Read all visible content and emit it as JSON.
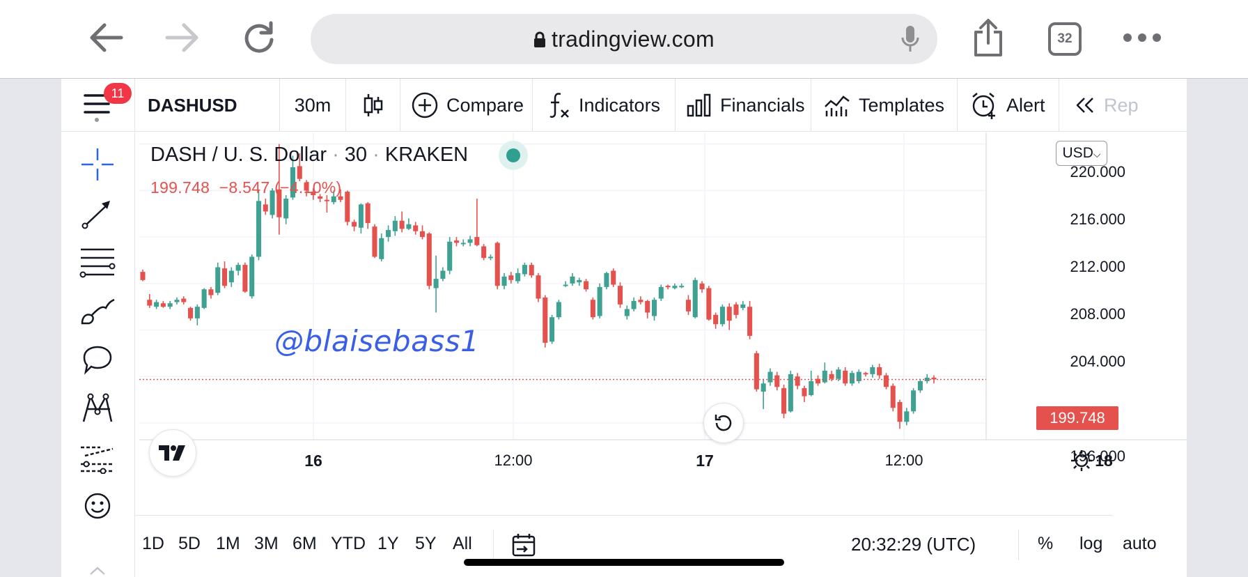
{
  "browser": {
    "url": "tradingview.com",
    "tab_count": "32",
    "icons": [
      "back-arrow-icon",
      "forward-arrow-icon",
      "reload-icon",
      "lock-icon",
      "microphone-icon",
      "share-icon",
      "tabs-icon",
      "more-icon"
    ]
  },
  "app": {
    "notification_count": "11",
    "toolbar": {
      "symbol": "DASHUSD",
      "interval": "30m",
      "compare": "Compare",
      "indicators": "Indicators",
      "financials": "Financials",
      "templates": "Templates",
      "alert": "Alert",
      "replay": "Rep"
    },
    "left_tools": [
      "crosshair-icon",
      "trend-line-icon",
      "fib-retracement-icon",
      "brush-icon",
      "comment-icon",
      "pattern-icon",
      "forecast-icon",
      "emoji-icon"
    ]
  },
  "legend": {
    "pair": "DASH / U. S. Dollar",
    "sep": "·",
    "interval": "30",
    "exchange": "KRAKEN",
    "last": "199.748",
    "change": "−8.547",
    "change_pct": "(−4.10%)"
  },
  "watermark": "@blaisebass1",
  "currency": "USD",
  "price_axis": [
    "220.000",
    "216.000",
    "212.000",
    "208.000",
    "204.000",
    "196.000"
  ],
  "last_price_label": "199.748",
  "time_axis": [
    "16",
    "12:00",
    "17",
    "12:00",
    "18"
  ],
  "bottom": {
    "ranges": [
      "1D",
      "5D",
      "1M",
      "3M",
      "6M",
      "YTD",
      "1Y",
      "5Y",
      "All"
    ],
    "clock": "20:32:29 (UTC)",
    "percent": "%",
    "log": "log",
    "auto": "auto"
  },
  "colors": {
    "up": "#3fa191",
    "down": "#e5514d",
    "accent": "#2962ff"
  },
  "chart_data": {
    "type": "candlestick",
    "symbol": "DASHUSD",
    "interval": "30",
    "y_range": [
      194.5,
      221.0
    ],
    "x_labels": [
      "16",
      "12:00",
      "17",
      "12:00",
      "18"
    ],
    "candles": [
      [
        209.0,
        208.3,
        209.2,
        208.2
      ],
      [
        206.6,
        206.1,
        207.1,
        205.9
      ],
      [
        206.0,
        206.4,
        206.6,
        205.8
      ],
      [
        206.3,
        206.0,
        206.5,
        205.9
      ],
      [
        206.0,
        206.3,
        206.5,
        205.8
      ],
      [
        206.4,
        206.6,
        206.8,
        206.2
      ],
      [
        206.7,
        206.4,
        206.9,
        206.2
      ],
      [
        205.9,
        205.0,
        206.0,
        204.8
      ],
      [
        205.0,
        206.0,
        206.2,
        204.4
      ],
      [
        205.9,
        207.5,
        207.6,
        205.8
      ],
      [
        207.5,
        207.0,
        207.7,
        206.7
      ],
      [
        207.2,
        209.4,
        209.8,
        207.0
      ],
      [
        209.3,
        207.8,
        209.9,
        207.6
      ],
      [
        208.1,
        209.1,
        209.4,
        207.7
      ],
      [
        209.1,
        209.6,
        209.8,
        208.7
      ],
      [
        209.6,
        207.3,
        209.8,
        207.2
      ],
      [
        206.9,
        210.3,
        210.5,
        206.7
      ],
      [
        210.3,
        215.1,
        216.0,
        210.0
      ],
      [
        214.8,
        214.2,
        215.3,
        213.9
      ],
      [
        213.9,
        216.0,
        216.2,
        213.6
      ],
      [
        216.1,
        213.7,
        220.0,
        212.2
      ],
      [
        213.6,
        215.3,
        215.6,
        213.1
      ],
      [
        215.4,
        218.0,
        219.0,
        215.2
      ],
      [
        218.1,
        217.0,
        219.2,
        216.8
      ],
      [
        216.7,
        216.0,
        216.9,
        215.5
      ],
      [
        215.9,
        215.6,
        216.2,
        215.2
      ],
      [
        215.5,
        215.3,
        215.7,
        215.0
      ],
      [
        215.2,
        215.1,
        215.6,
        214.1
      ],
      [
        215.0,
        215.5,
        216.0,
        214.8
      ],
      [
        215.5,
        215.2,
        216.1,
        215.0
      ],
      [
        215.9,
        213.3,
        216.0,
        213.0
      ],
      [
        213.3,
        212.9,
        213.5,
        212.5
      ],
      [
        212.8,
        214.8,
        214.9,
        212.3
      ],
      [
        214.9,
        213.2,
        215.0,
        212.7
      ],
      [
        212.9,
        210.3,
        213.1,
        210.2
      ],
      [
        210.1,
        211.9,
        212.3,
        209.9
      ],
      [
        212.0,
        212.6,
        213.0,
        211.6
      ],
      [
        212.5,
        213.4,
        213.8,
        212.1
      ],
      [
        213.4,
        212.7,
        214.2,
        212.4
      ],
      [
        212.7,
        213.1,
        213.6,
        212.6
      ],
      [
        213.0,
        212.5,
        213.3,
        212.2
      ],
      [
        212.5,
        212.0,
        213.0,
        211.8
      ],
      [
        212.3,
        207.8,
        212.4,
        207.5
      ],
      [
        207.6,
        208.4,
        210.4,
        205.5
      ],
      [
        208.4,
        209.1,
        209.4,
        208.2
      ],
      [
        209.1,
        211.6,
        212.0,
        208.8
      ],
      [
        211.7,
        211.5,
        212.0,
        211.2
      ],
      [
        211.5,
        211.5,
        211.8,
        211.2
      ],
      [
        211.5,
        211.8,
        212.1,
        211.2
      ],
      [
        212.0,
        211.3,
        215.3,
        211.2
      ],
      [
        211.2,
        210.2,
        211.4,
        210.0
      ],
      [
        210.2,
        210.3,
        210.5,
        210.0
      ],
      [
        211.5,
        207.8,
        211.6,
        207.5
      ],
      [
        207.8,
        208.6,
        208.9,
        207.5
      ],
      [
        208.7,
        208.3,
        209.0,
        208.0
      ],
      [
        208.2,
        208.9,
        209.3,
        208.0
      ],
      [
        208.8,
        209.6,
        209.8,
        208.6
      ],
      [
        209.6,
        208.7,
        209.8,
        208.5
      ],
      [
        208.7,
        206.7,
        208.9,
        206.4
      ],
      [
        206.8,
        202.9,
        207.0,
        202.5
      ],
      [
        203.0,
        205.1,
        205.3,
        202.8
      ],
      [
        205.1,
        206.4,
        206.6,
        204.9
      ],
      [
        207.9,
        207.9,
        208.2,
        207.7
      ],
      [
        208.0,
        208.6,
        208.9,
        207.8
      ],
      [
        208.1,
        208.3,
        208.5,
        207.8
      ],
      [
        208.2,
        207.5,
        208.4,
        207.3
      ],
      [
        206.6,
        205.1,
        206.8,
        204.9
      ],
      [
        205.2,
        207.7,
        208.0,
        205.0
      ],
      [
        207.7,
        208.9,
        209.0,
        207.5
      ],
      [
        209.1,
        207.9,
        209.3,
        207.7
      ],
      [
        207.8,
        206.2,
        208.1,
        205.9
      ],
      [
        205.2,
        205.8,
        206.1,
        204.9
      ],
      [
        205.8,
        206.5,
        206.8,
        205.6
      ],
      [
        206.6,
        206.4,
        206.9,
        206.2
      ],
      [
        206.5,
        205.5,
        206.6,
        205.0
      ],
      [
        205.2,
        206.6,
        206.8,
        204.8
      ],
      [
        206.7,
        207.7,
        207.9,
        206.5
      ],
      [
        207.8,
        207.7,
        207.9,
        207.5
      ],
      [
        207.6,
        207.8,
        208.0,
        207.5
      ],
      [
        207.8,
        207.8,
        208.0,
        207.6
      ],
      [
        206.6,
        205.6,
        207.0,
        205.3
      ],
      [
        205.1,
        208.3,
        208.5,
        205.0
      ],
      [
        208.0,
        207.5,
        208.2,
        207.2
      ],
      [
        207.6,
        204.9,
        207.8,
        204.8
      ],
      [
        205.3,
        204.5,
        205.5,
        204.1
      ],
      [
        204.5,
        206.0,
        206.2,
        204.3
      ],
      [
        206.0,
        204.8,
        206.3,
        204.0
      ],
      [
        206.2,
        205.3,
        206.4,
        205.0
      ],
      [
        205.9,
        206.2,
        206.5,
        205.7
      ],
      [
        206.0,
        203.5,
        206.5,
        203.2
      ],
      [
        202.0,
        198.9,
        202.2,
        198.7
      ],
      [
        198.7,
        199.4,
        199.8,
        197.2
      ],
      [
        199.5,
        200.4,
        200.7,
        199.2
      ],
      [
        200.1,
        199.1,
        200.4,
        198.8
      ],
      [
        199.0,
        196.8,
        199.3,
        196.4
      ],
      [
        197.0,
        200.2,
        200.5,
        196.9
      ],
      [
        200.0,
        199.2,
        200.3,
        198.9
      ],
      [
        199.0,
        198.3,
        199.2,
        197.8
      ],
      [
        198.4,
        199.6,
        200.5,
        198.3
      ],
      [
        199.8,
        199.4,
        200.1,
        199.2
      ],
      [
        199.5,
        200.5,
        201.2,
        199.4
      ],
      [
        200.2,
        199.8,
        200.5,
        199.6
      ],
      [
        199.8,
        200.6,
        200.8,
        199.6
      ],
      [
        200.5,
        199.4,
        200.8,
        199.2
      ],
      [
        199.4,
        200.3,
        200.5,
        199.2
      ],
      [
        199.6,
        200.4,
        200.6,
        199.4
      ],
      [
        200.3,
        200.2,
        200.4,
        200.0
      ],
      [
        200.2,
        200.8,
        201.0,
        199.9
      ],
      [
        200.8,
        200.1,
        201.1,
        199.8
      ],
      [
        200.1,
        199.1,
        200.3,
        198.9
      ],
      [
        199.2,
        197.3,
        199.4,
        197.0
      ],
      [
        197.8,
        196.1,
        198.0,
        195.5
      ],
      [
        196.1,
        197.0,
        197.3,
        195.8
      ],
      [
        197.0,
        198.8,
        199.0,
        196.8
      ],
      [
        198.8,
        199.6,
        199.8,
        198.6
      ],
      [
        199.6,
        199.9,
        200.2,
        199.4
      ],
      [
        199.9,
        199.748,
        200.1,
        199.4
      ]
    ]
  }
}
